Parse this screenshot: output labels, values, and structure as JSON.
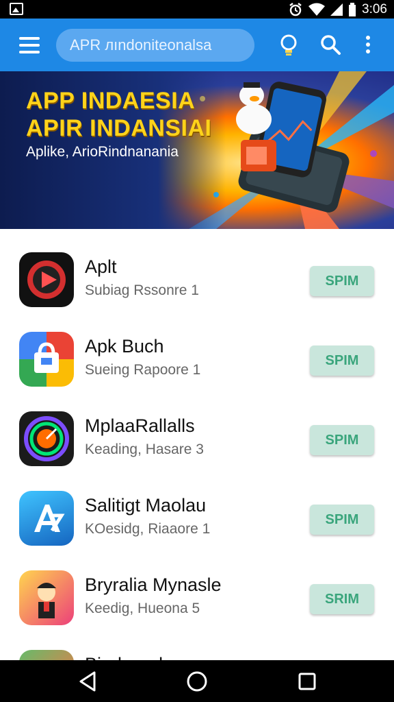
{
  "status_bar": {
    "time": "3:06"
  },
  "app_bar": {
    "search_text": "APR лındoniteonalsa"
  },
  "banner": {
    "title_line1": "APP INDAESIA",
    "title_line2": "APIR INDANSIAI",
    "subtitle": "Aplike, ArioRindnanania"
  },
  "apps": [
    {
      "name": "Aplt",
      "subtitle": "Subiag Rssonre 1",
      "action": "SPIM",
      "icon": "play-icon"
    },
    {
      "name": "Apk Buch",
      "subtitle": "Sueing Rapoore 1",
      "action": "SPIM",
      "icon": "store-bag-icon"
    },
    {
      "name": "MplaaRallalls",
      "subtitle": "Keading, Hasare 3",
      "action": "SPIM",
      "icon": "dial-icon"
    },
    {
      "name": "Salitigt Maolau",
      "subtitle": "KOesidg, Riaaore 1",
      "action": "SPIM",
      "icon": "letter-a-icon"
    },
    {
      "name": "Bryralia Mynasle",
      "subtitle": "Keedig, Hueona 5",
      "action": "SRIM",
      "icon": "character-icon"
    },
    {
      "name": "Bigdanada",
      "subtitle": "",
      "action": "",
      "icon": "game-icon"
    }
  ],
  "colors": {
    "app_bar": "#1e88e5",
    "button_bg": "#c9e6dc",
    "button_text": "#3aa57c"
  }
}
